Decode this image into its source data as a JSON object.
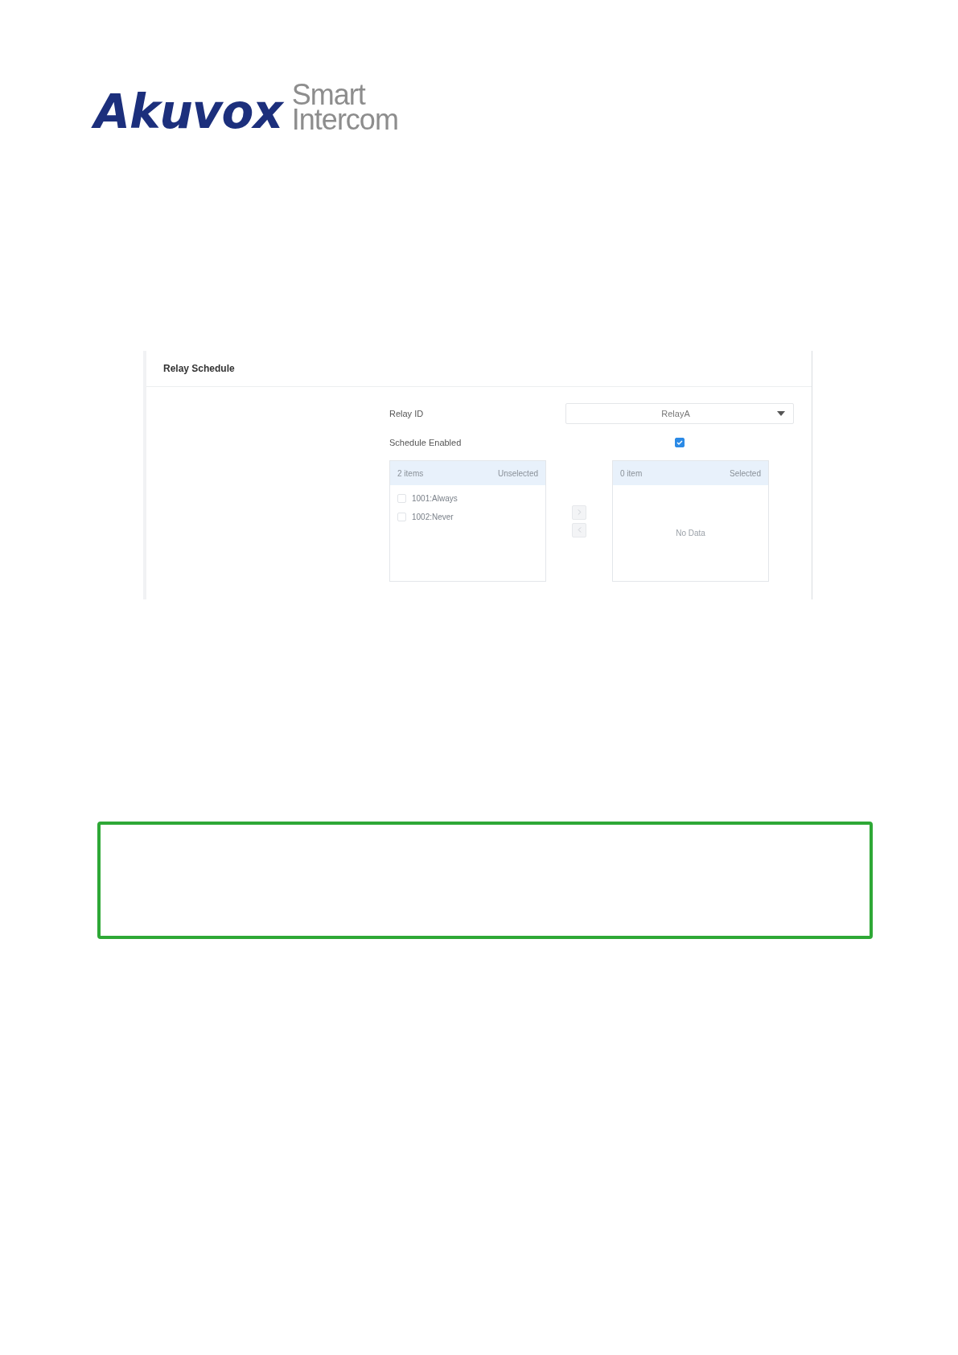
{
  "logo": {
    "brand": "Akuvox",
    "tagline": [
      "Smart",
      "Intercom"
    ]
  },
  "panel": {
    "title": "Relay Schedule",
    "fields": [
      {
        "kind": "select",
        "label": "Relay ID",
        "value": "RelayA"
      },
      {
        "kind": "checkbox",
        "label": "Schedule Enabled",
        "checked": true
      }
    ],
    "transfer": {
      "source": {
        "count": "2 items",
        "title": "Unselected",
        "items": [
          {
            "label": "1001:Always",
            "checked": false
          },
          {
            "label": "1002:Never",
            "checked": false
          }
        ]
      },
      "buttons": [
        {
          "kind": "right",
          "disabled": true
        },
        {
          "kind": "left",
          "disabled": true
        }
      ],
      "target": {
        "count": "0 item",
        "title": "Selected",
        "empty": "No Data"
      }
    }
  }
}
